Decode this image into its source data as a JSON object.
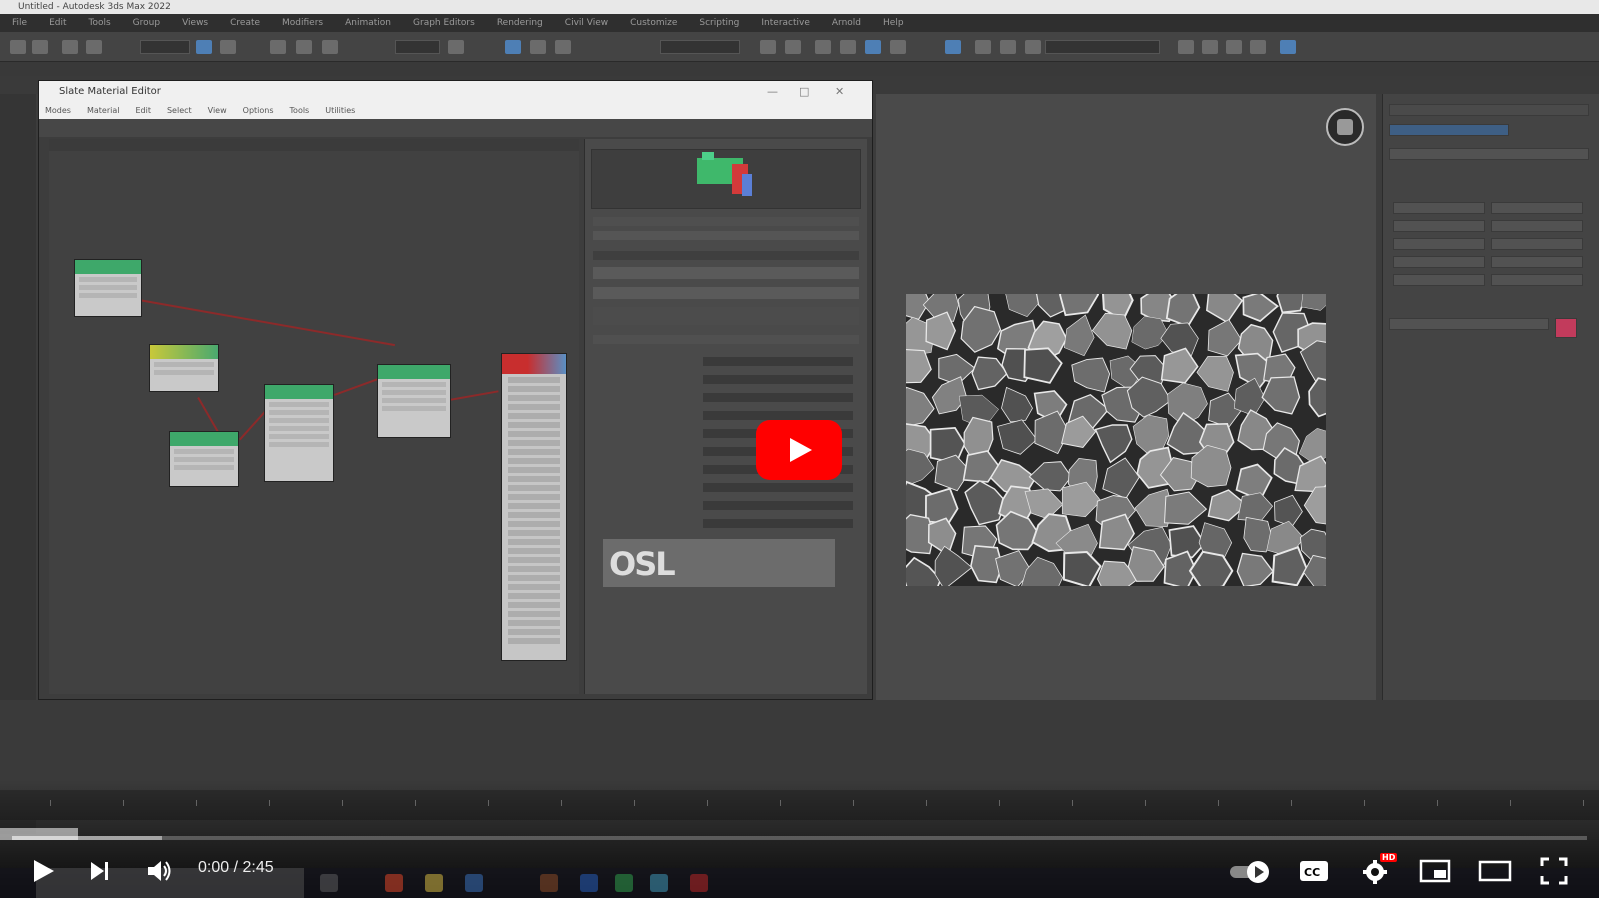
{
  "app": {
    "window_title": "Untitled - Autodesk 3ds Max 2022",
    "menus": [
      "File",
      "Edit",
      "Tools",
      "Group",
      "Views",
      "Create",
      "Modifiers",
      "Animation",
      "Graph Editors",
      "Rendering",
      "Civil View",
      "Customize",
      "Scripting",
      "Interactive",
      "Arnold",
      "Help"
    ]
  },
  "slate": {
    "title": "Slate Material Editor",
    "menus": [
      "Modes",
      "Material",
      "Edit",
      "Select",
      "View",
      "Options",
      "Tools",
      "Utilities"
    ],
    "logo_text": "OSL"
  },
  "player": {
    "time_display": "0:00 / 2:45",
    "hd_badge": "HD",
    "progress_fraction": 0.0,
    "buffered_fraction": 0.095,
    "accent_color": "#ff0000"
  },
  "icons": {
    "play": "play-icon",
    "next": "next-icon",
    "volume": "volume-icon",
    "autoplay": "autoplay-toggle-icon",
    "captions": "captions-icon",
    "settings": "settings-gear-icon",
    "miniplayer": "miniplayer-icon",
    "theater": "theater-mode-icon",
    "fullscreen": "fullscreen-icon"
  }
}
